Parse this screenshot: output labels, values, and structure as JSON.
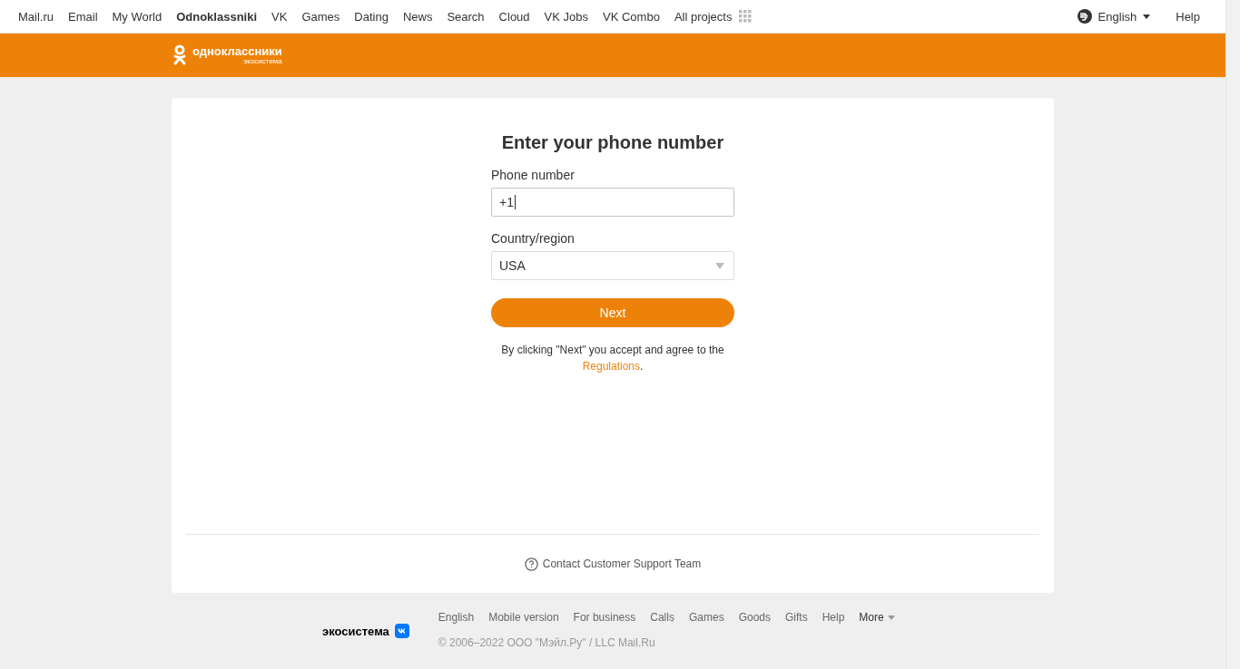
{
  "top_nav": {
    "items": [
      {
        "label": "Mail.ru",
        "selected": false
      },
      {
        "label": "Email",
        "selected": false
      },
      {
        "label": "My World",
        "selected": false
      },
      {
        "label": "Odnoklassniki",
        "selected": true
      },
      {
        "label": "VK",
        "selected": false
      },
      {
        "label": "Games",
        "selected": false
      },
      {
        "label": "Dating",
        "selected": false
      },
      {
        "label": "News",
        "selected": false
      },
      {
        "label": "Search",
        "selected": false
      },
      {
        "label": "Cloud",
        "selected": false
      },
      {
        "label": "VK Jobs",
        "selected": false
      },
      {
        "label": "VK Combo",
        "selected": false
      },
      {
        "label": "All projects",
        "selected": false
      }
    ],
    "language": "English",
    "help": "Help"
  },
  "header": {
    "logo_name": "одноклассники",
    "logo_sub": "экосистема"
  },
  "form": {
    "title": "Enter your phone number",
    "phone": {
      "label": "Phone number",
      "value": "+1"
    },
    "country": {
      "label": "Country/region",
      "value": "USA"
    },
    "next_button": "Next",
    "agreement": {
      "text": "By clicking \"Next\" you accept and agree to the",
      "link": "Regulations",
      "after": "."
    },
    "support_link": "Contact Customer Support Team"
  },
  "footer": {
    "brand": "экосистема",
    "links": [
      "English",
      "Mobile version",
      "For business",
      "Calls",
      "Games",
      "Goods",
      "Gifts",
      "Help"
    ],
    "more": "More",
    "copyright": "© 2006–2022 ООО \"Мэйл.Ру\" / LLC Mail.Ru"
  }
}
